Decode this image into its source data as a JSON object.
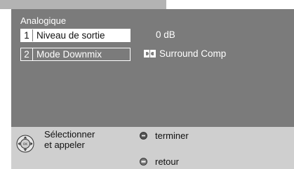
{
  "panel": {
    "title": "Analogique"
  },
  "menu": {
    "items": [
      {
        "number": "1",
        "label": "Niveau de sortie",
        "value": "0 dB",
        "selected": true
      },
      {
        "number": "2",
        "label": "Mode Downmix",
        "value": "Surround Comp",
        "value_icon": "dolby-icon",
        "selected": false
      }
    ]
  },
  "help": {
    "select_line1": "Sélectionner",
    "select_line2": "et appeler",
    "finish_label": "terminer",
    "back_label": "retour",
    "icons": [
      "nav-ring-icon",
      "finish-button-icon",
      "back-button-icon"
    ]
  },
  "colors": {
    "panel_bg": "#7b7b7b",
    "help_bg": "#cfcfcf",
    "tab_bg": "#b3b3b3",
    "text_light": "#ffffff",
    "text_dark": "#111111"
  }
}
